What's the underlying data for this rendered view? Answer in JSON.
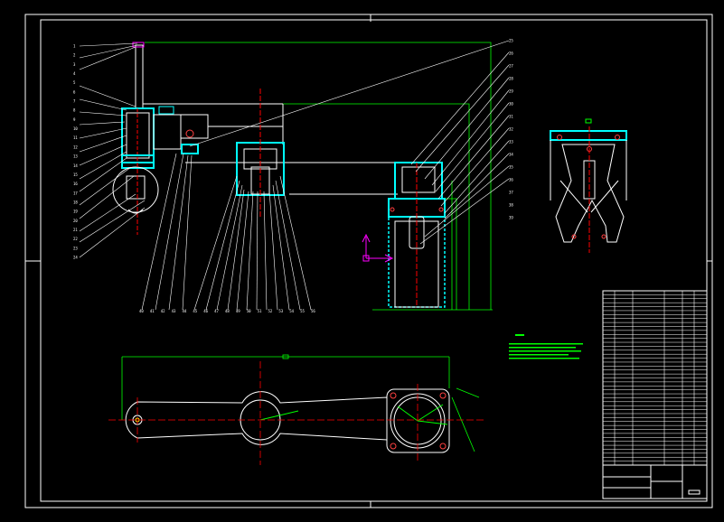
{
  "drawing": {
    "background": "#000000",
    "colors": {
      "outline": "#ffffff",
      "dimension": "#00ff00",
      "centerline": "#ff0000",
      "section": "#00ffff",
      "axis_up": "#ff00ff",
      "hole": "#ff4040"
    },
    "ucs": {
      "icon_name": "ucs-axis-icon"
    },
    "balloons_left": [
      "1",
      "2",
      "3",
      "4",
      "5",
      "6",
      "7",
      "8",
      "9",
      "10",
      "11",
      "12",
      "13",
      "14",
      "15",
      "16",
      "17",
      "18",
      "19",
      "20",
      "21",
      "22",
      "23",
      "24"
    ],
    "balloons_right": [
      "25",
      "26",
      "27",
      "28",
      "29",
      "30",
      "31",
      "32",
      "33",
      "34",
      "35",
      "36",
      "37",
      "38",
      "39"
    ],
    "balloons_bottom": [
      "40",
      "41",
      "42",
      "43",
      "44",
      "45",
      "46",
      "47",
      "48",
      "49",
      "50",
      "51",
      "52",
      "53",
      "54",
      "55",
      "56"
    ],
    "title_block": {
      "rows": 44
    }
  }
}
